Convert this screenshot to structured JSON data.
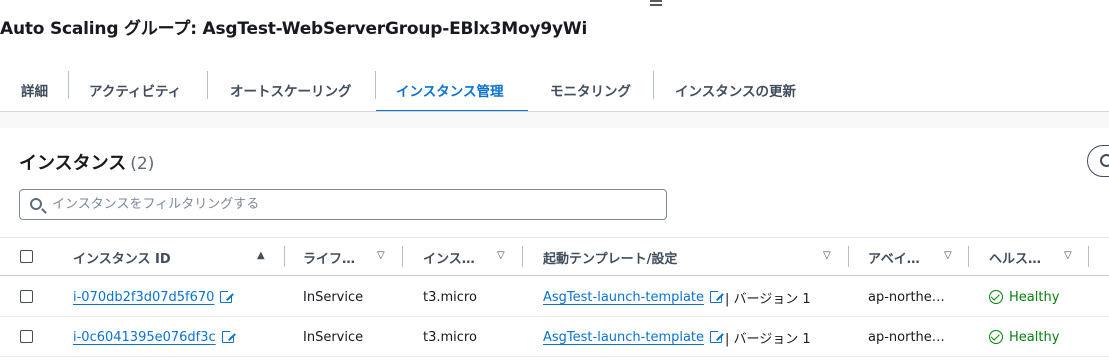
{
  "header": {
    "title": "Auto Scaling グループ: AsgTest-WebServerGroup-EBlx3Moy9yWi"
  },
  "tabs": [
    {
      "label": "詳細",
      "active": false
    },
    {
      "label": "アクティビティ",
      "active": false
    },
    {
      "label": "オートスケーリング",
      "active": false
    },
    {
      "label": "インスタンス管理",
      "active": true
    },
    {
      "label": "モニタリング",
      "active": false
    },
    {
      "label": "インスタンスの更新",
      "active": false
    }
  ],
  "instances": {
    "title": "インスタンス",
    "count": "(2)",
    "search_placeholder": "インスタンスをフィルタリングする",
    "columns": [
      {
        "label": "インスタンス ID",
        "sort": "▲"
      },
      {
        "label": "ライフ…",
        "sort": "▽"
      },
      {
        "label": "インス…",
        "sort": "▽"
      },
      {
        "label": "起動テンプレート/設定",
        "sort": "▽"
      },
      {
        "label": "アベイ…",
        "sort": "▽"
      },
      {
        "label": "ヘルス…",
        "sort": "▽"
      }
    ],
    "rows": [
      {
        "id": "i-070db2f3d07d5f670",
        "lifecycle": "InService",
        "type": "t3.micro",
        "template": "AsgTest-launch-template",
        "version": "| バージョン 1",
        "az": "ap-northe…",
        "health": "Healthy"
      },
      {
        "id": "i-0c6041395e076df3c",
        "lifecycle": "InService",
        "type": "t3.micro",
        "template": "AsgTest-launch-template",
        "version": "| バージョン 1",
        "az": "ap-northe…",
        "health": "Healthy"
      }
    ]
  },
  "colors": {
    "accent": "#0972d3",
    "healthy": "#037f0c",
    "text": "#16191f"
  }
}
